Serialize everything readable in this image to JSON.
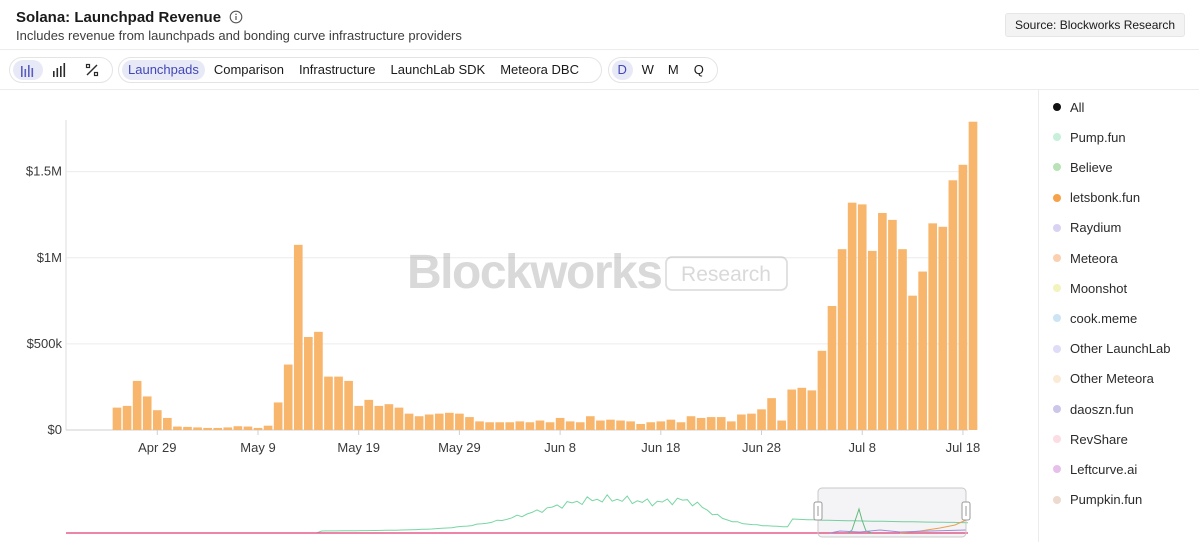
{
  "header": {
    "title": "Solana: Launchpad Revenue",
    "subtitle": "Includes revenue from launchpads and bonding curve infrastructure providers",
    "source_label": "Source: Blockworks Research",
    "info_icon": "info-circle-icon"
  },
  "toolbar": {
    "chart_types": [
      {
        "icon": "bar-chart-icon",
        "active": true
      },
      {
        "icon": "stacked-bar-icon",
        "active": false
      },
      {
        "icon": "percent-icon",
        "active": false
      }
    ],
    "tabs": [
      {
        "label": "Launchpads",
        "active": true
      },
      {
        "label": "Comparison",
        "active": false
      },
      {
        "label": "Infrastructure",
        "active": false
      },
      {
        "label": "LaunchLab SDK",
        "active": false
      },
      {
        "label": "Meteora DBC",
        "active": false
      }
    ],
    "periods": [
      {
        "label": "D",
        "active": true
      },
      {
        "label": "W",
        "active": false
      },
      {
        "label": "M",
        "active": false
      },
      {
        "label": "Q",
        "active": false
      }
    ]
  },
  "watermark": {
    "brand": "Blockworks",
    "badge": "Research"
  },
  "legend": [
    {
      "label": "All",
      "color": "#111111"
    },
    {
      "label": "Pump.fun",
      "color": "#c7efd9"
    },
    {
      "label": "Believe",
      "color": "#b9e2b6"
    },
    {
      "label": "letsbonk.fun",
      "color": "#f7a24a"
    },
    {
      "label": "Raydium",
      "color": "#d9d2f3"
    },
    {
      "label": "Meteora",
      "color": "#fbd0b0"
    },
    {
      "label": "Moonshot",
      "color": "#f3f3bd"
    },
    {
      "label": "cook.meme",
      "color": "#cde4f4"
    },
    {
      "label": "Other LaunchLab",
      "color": "#dedcf7"
    },
    {
      "label": "Other Meteora",
      "color": "#fbebd6"
    },
    {
      "label": "daoszn.fun",
      "color": "#cbc6ea"
    },
    {
      "label": "RevShare",
      "color": "#fbdde3"
    },
    {
      "label": "Leftcurve.ai",
      "color": "#e6c0ea"
    },
    {
      "label": "Pumpkin.fun",
      "color": "#eed9ce"
    }
  ],
  "chart_data": {
    "type": "bar",
    "series_name": "letsbonk.fun",
    "color": "#f8b66d",
    "x_tick_labels": [
      "Apr 29",
      "May 9",
      "May 19",
      "May 29",
      "Jun 8",
      "Jun 18",
      "Jun 28",
      "Jul 8",
      "Jul 18"
    ],
    "y_tick_labels": [
      "$0",
      "$500k",
      "$1M",
      "$1.5M"
    ],
    "ylim": [
      0,
      1800000
    ],
    "x_start": "2025-04-25",
    "x_end": "2025-07-18",
    "values": [
      130000,
      140000,
      285000,
      195000,
      115000,
      70000,
      20000,
      18000,
      15000,
      12000,
      12000,
      15000,
      22000,
      20000,
      12000,
      25000,
      160000,
      380000,
      1075000,
      540000,
      570000,
      310000,
      310000,
      285000,
      140000,
      175000,
      140000,
      150000,
      130000,
      95000,
      80000,
      90000,
      95000,
      100000,
      95000,
      75000,
      50000,
      45000,
      45000,
      45000,
      50000,
      45000,
      55000,
      45000,
      70000,
      50000,
      45000,
      80000,
      55000,
      60000,
      55000,
      50000,
      35000,
      45000,
      50000,
      60000,
      45000,
      80000,
      70000,
      75000,
      75000,
      50000,
      90000,
      95000,
      120000,
      185000,
      55000,
      235000,
      245000,
      230000,
      460000,
      720000,
      1050000,
      1320000,
      1310000,
      1040000,
      1260000,
      1220000,
      1050000,
      780000,
      920000,
      1200000,
      1180000,
      1450000,
      1540000,
      1790000
    ],
    "navigator": {
      "series": [
        {
          "name": "Pump.fun",
          "color": "#77d6a3"
        },
        {
          "name": "Believe",
          "color": "#62c07a"
        },
        {
          "name": "letsbonk.fun",
          "color": "#f7a24a"
        },
        {
          "name": "Raydium",
          "color": "#a28fe0"
        },
        {
          "name": "RevShare",
          "color": "#e85b8a"
        }
      ]
    }
  }
}
